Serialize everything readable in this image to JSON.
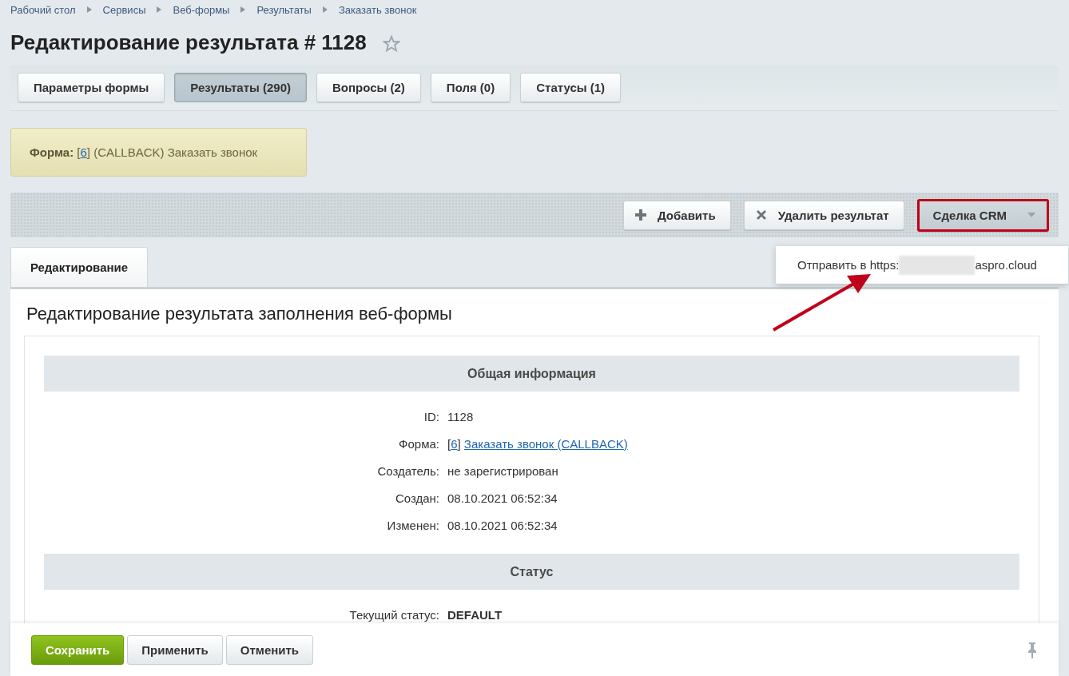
{
  "breadcrumbs": [
    "Рабочий стол",
    "Сервисы",
    "Веб-формы",
    "Результаты",
    "Заказать звонок"
  ],
  "title": "Редактирование результата # 1128",
  "favorite": false,
  "tabs": [
    {
      "label": "Параметры формы",
      "selected": false
    },
    {
      "label": "Результаты (290)",
      "selected": true
    },
    {
      "label": "Вопросы (2)",
      "selected": false
    },
    {
      "label": "Поля (0)",
      "selected": false
    },
    {
      "label": "Статусы (1)",
      "selected": false
    }
  ],
  "note": {
    "label": "Форма:",
    "parts": [
      {
        "kind": "text",
        "text": "["
      },
      {
        "kind": "link",
        "text": "6"
      },
      {
        "kind": "text",
        "text": "] (CALLBACK) Заказать звонок"
      }
    ]
  },
  "toolbar": [
    {
      "kind": "add",
      "label": "Добавить",
      "highlighted": false
    },
    {
      "kind": "delete",
      "label": "Удалить результат",
      "highlighted": false
    },
    {
      "kind": "dropdown",
      "label": "Сделка CRM",
      "highlighted": true
    }
  ],
  "dropdown_menu": {
    "prefix": "Отправить в https:",
    "suffix": "aspro.cloud"
  },
  "edit_tabs": [
    {
      "label": "Редактирование",
      "selected": true
    }
  ],
  "form_heading": "Редактирование результата заполнения веб-формы",
  "sections": [
    {
      "title": "Общая информация",
      "rows": [
        {
          "label": "ID:",
          "parts": [
            {
              "kind": "text",
              "text": "1128"
            }
          ]
        },
        {
          "label": "Форма:",
          "parts": [
            {
              "kind": "text",
              "text": "["
            },
            {
              "kind": "link",
              "text": "6"
            },
            {
              "kind": "text",
              "text": "] "
            },
            {
              "kind": "link",
              "text": "Заказать звонок (CALLBACK)"
            }
          ]
        },
        {
          "label": "Создатель:",
          "parts": [
            {
              "kind": "text",
              "text": "не зарегистрирован"
            }
          ]
        },
        {
          "label": "Создан:",
          "parts": [
            {
              "kind": "text",
              "text": "08.10.2021 06:52:34"
            }
          ]
        },
        {
          "label": "Изменен:",
          "parts": [
            {
              "kind": "text",
              "text": "08.10.2021 06:52:34"
            }
          ]
        }
      ]
    },
    {
      "title": "Статус",
      "rows": [
        {
          "label": "Текущий статус:",
          "parts": [
            {
              "kind": "bold",
              "text": "DEFAULT"
            }
          ]
        }
      ]
    }
  ],
  "footer_buttons": [
    {
      "label": "Сохранить",
      "primary": true
    },
    {
      "label": "Применить",
      "primary": false
    },
    {
      "label": "Отменить",
      "primary": false
    }
  ]
}
